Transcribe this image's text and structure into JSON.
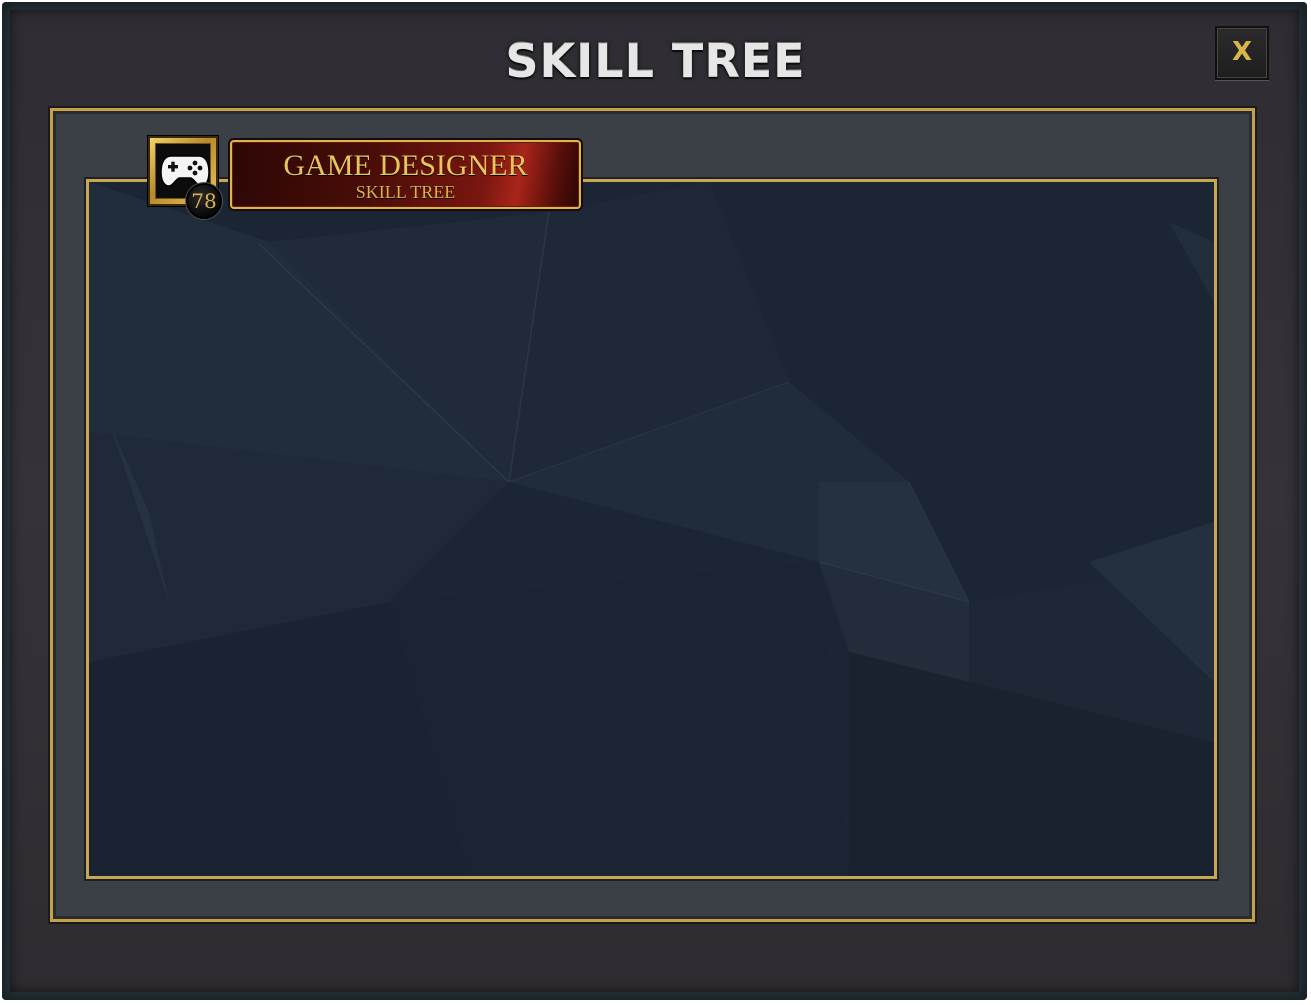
{
  "window": {
    "title": "SKILL TREE",
    "close_label": "X"
  },
  "skill": {
    "name": "GAME DESIGNER",
    "subtitle": "SKILL TREE",
    "level": "78",
    "icon": "gamepad-icon"
  },
  "colors": {
    "gold_frame": "#c9a74f",
    "gold_text": "#e8c45c",
    "plate_red": "#7a1610",
    "panel_bg": "#1b2431",
    "window_bg": "#353339"
  }
}
